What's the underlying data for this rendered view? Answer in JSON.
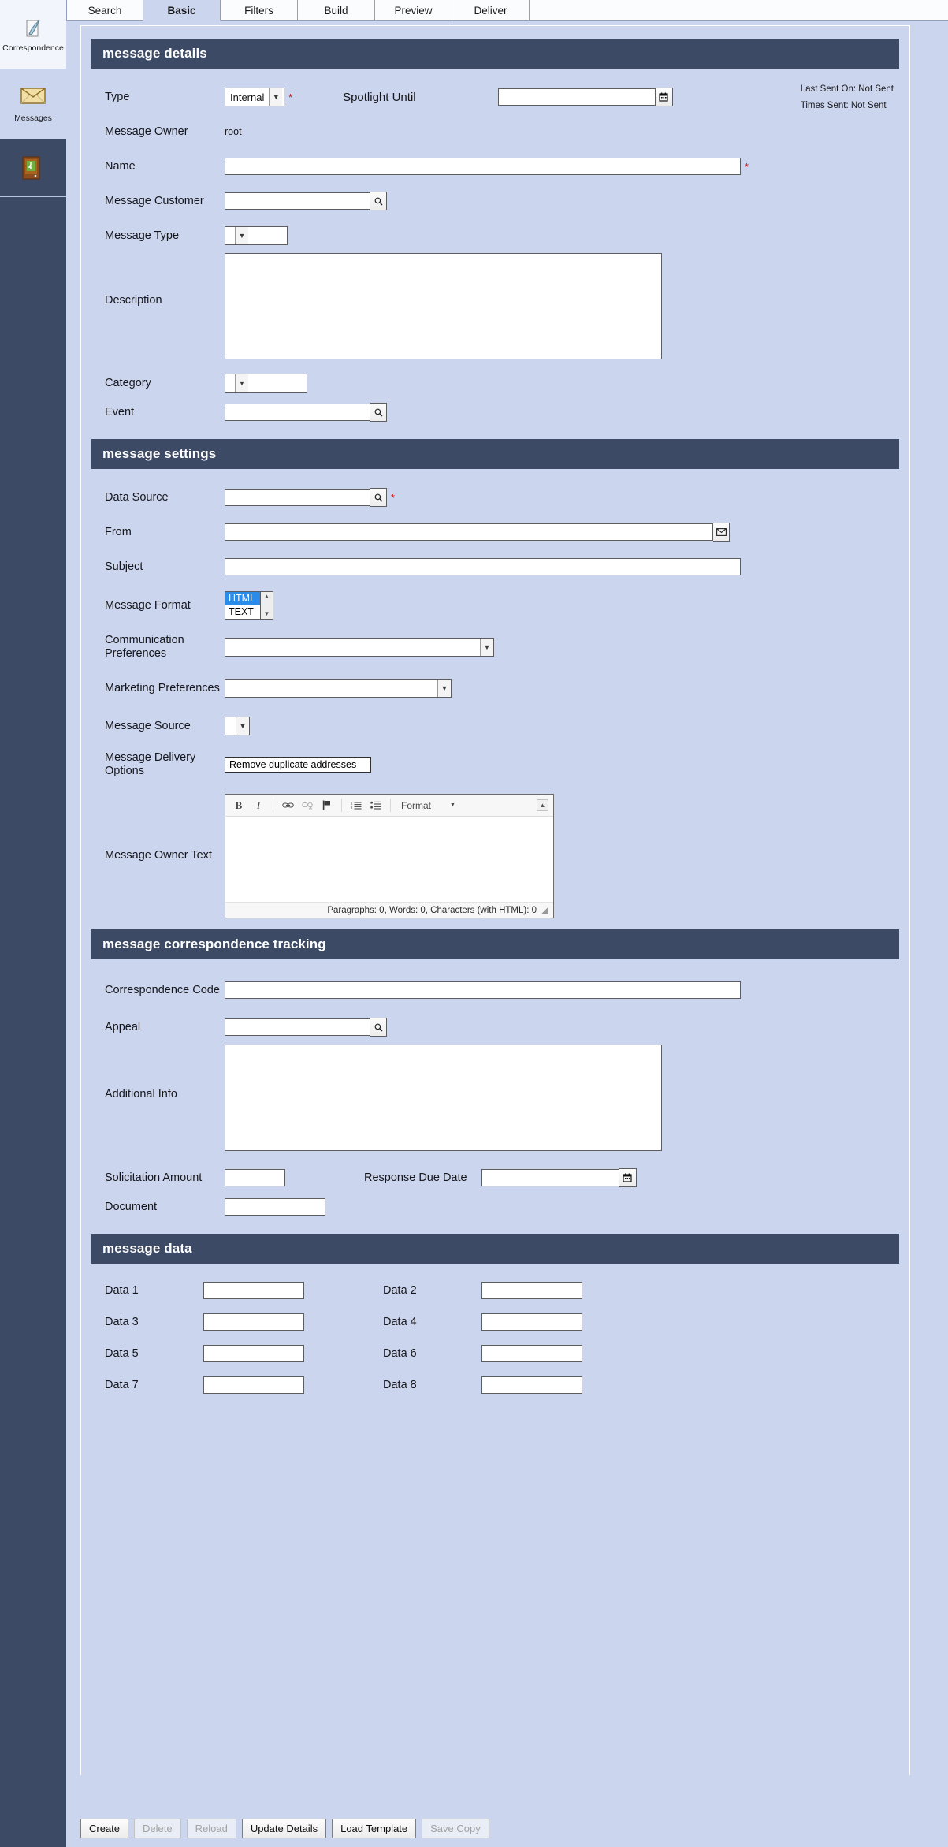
{
  "sidebar": {
    "items": [
      {
        "label": "Correspondence",
        "icon": "quill-pen-icon"
      },
      {
        "label": "Messages",
        "icon": "envelope-icon"
      },
      {
        "label": "",
        "icon": "exit-door-icon"
      }
    ]
  },
  "tabs": [
    {
      "label": "Search",
      "active": false
    },
    {
      "label": "Basic",
      "active": true
    },
    {
      "label": "Filters",
      "active": false
    },
    {
      "label": "Build",
      "active": false
    },
    {
      "label": "Preview",
      "active": false
    },
    {
      "label": "Deliver",
      "active": false
    }
  ],
  "sections": {
    "details": {
      "title": "message details",
      "type_label": "Type",
      "type_value": "Internal",
      "type_required": "*",
      "spotlight_label": "Spotlight Until",
      "spotlight_value": "",
      "last_sent_label": "Last Sent On:",
      "last_sent_value": "Not Sent",
      "times_sent_label": "Times Sent:",
      "times_sent_value": "Not Sent",
      "owner_label": "Message Owner",
      "owner_value": "root",
      "name_label": "Name",
      "name_value": "",
      "name_required": "*",
      "customer_label": "Message Customer",
      "customer_value": "",
      "message_type_label": "Message Type",
      "message_type_value": "",
      "description_label": "Description",
      "description_value": "",
      "category_label": "Category",
      "category_value": "",
      "event_label": "Event",
      "event_value": ""
    },
    "settings": {
      "title": "message settings",
      "data_source_label": "Data Source",
      "data_source_value": "",
      "data_source_required": "*",
      "from_label": "From",
      "from_value": "",
      "subject_label": "Subject",
      "subject_value": "",
      "format_label": "Message Format",
      "format_options": [
        "HTML",
        "TEXT"
      ],
      "format_selected": "HTML",
      "comm_pref_label": "Communication Preferences",
      "comm_pref_value": "",
      "mkt_pref_label": "Marketing Preferences",
      "mkt_pref_value": "",
      "msg_source_label": "Message Source",
      "msg_source_value": "",
      "delivery_label": "Message Delivery Options",
      "delivery_option": "Remove duplicate addresses",
      "owner_text_label": "Message Owner Text",
      "editor": {
        "buttons": [
          "B",
          "I",
          "link",
          "unlink",
          "anchor",
          "numbered-list",
          "bulleted-list"
        ],
        "format_label": "Format",
        "body_value": "",
        "status": "Paragraphs: 0, Words: 0, Characters (with HTML): 0"
      }
    },
    "tracking": {
      "title": "message correspondence tracking",
      "corr_code_label": "Correspondence Code",
      "corr_code_value": "",
      "appeal_label": "Appeal",
      "appeal_value": "",
      "additional_info_label": "Additional Info",
      "additional_info_value": "",
      "solicitation_label": "Solicitation Amount",
      "solicitation_value": "",
      "response_due_label": "Response Due Date",
      "response_due_value": "",
      "document_label": "Document",
      "document_value": ""
    },
    "data": {
      "title": "message data",
      "fields": [
        {
          "label": "Data 1",
          "value": ""
        },
        {
          "label": "Data 2",
          "value": ""
        },
        {
          "label": "Data 3",
          "value": ""
        },
        {
          "label": "Data 4",
          "value": ""
        },
        {
          "label": "Data 5",
          "value": ""
        },
        {
          "label": "Data 6",
          "value": ""
        },
        {
          "label": "Data 7",
          "value": ""
        },
        {
          "label": "Data 8",
          "value": ""
        }
      ]
    }
  },
  "footer": {
    "buttons": [
      {
        "label": "Create",
        "disabled": false
      },
      {
        "label": "Delete",
        "disabled": true
      },
      {
        "label": "Reload",
        "disabled": true
      },
      {
        "label": "Update Details",
        "disabled": false
      },
      {
        "label": "Load Template",
        "disabled": false
      },
      {
        "label": "Save Copy",
        "disabled": true
      }
    ]
  },
  "colors": {
    "page_bg": "#ccd5ee",
    "section_bar": "#3d4a66",
    "rail_bg": "#3d4a66",
    "required": "#d01414",
    "listbox_selected": "#2a8ce8"
  }
}
